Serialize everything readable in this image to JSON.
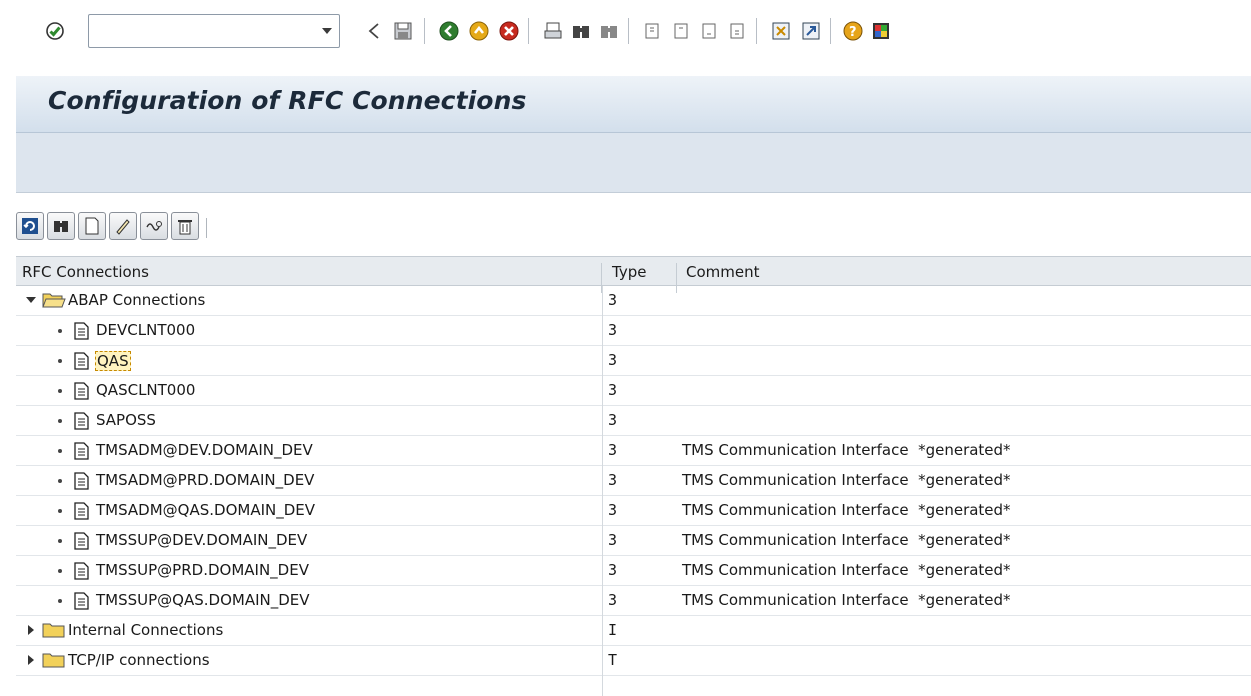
{
  "toolbar": {
    "command_field_value": "",
    "icons": [
      "enter-icon",
      "command-dropdown-icon",
      "back-icon",
      "save-icon",
      "back-green-icon",
      "exit-icon",
      "cancel-icon",
      "print-icon",
      "find-icon",
      "find-next-icon",
      "first-page-icon",
      "previous-page-icon",
      "next-page-icon",
      "last-page-icon",
      "create-session-icon",
      "shortcut-icon",
      "help-icon",
      "customize-layout-icon"
    ]
  },
  "title": "Configuration of RFC Connections",
  "tree_toolbar": {
    "buttons": [
      "refresh-icon",
      "find-icon",
      "create-icon",
      "change-icon",
      "test-connection-icon",
      "delete-icon"
    ]
  },
  "grid": {
    "headers": {
      "name": "RFC Connections",
      "type": "Type",
      "comment": "Comment"
    },
    "nodes": [
      {
        "kind": "folder",
        "expanded": true,
        "label": "ABAP Connections",
        "type": "3",
        "comment": ""
      },
      {
        "kind": "item",
        "label": "DEVCLNT000",
        "type": "3",
        "comment": ""
      },
      {
        "kind": "item",
        "label": "QAS",
        "type": "3",
        "comment": "",
        "selected": true
      },
      {
        "kind": "item",
        "label": "QASCLNT000",
        "type": "3",
        "comment": ""
      },
      {
        "kind": "item",
        "label": "SAPOSS",
        "type": "3",
        "comment": ""
      },
      {
        "kind": "item",
        "label": "TMSADM@DEV.DOMAIN_DEV",
        "type": "3",
        "comment": "TMS Communication Interface  *generated*"
      },
      {
        "kind": "item",
        "label": "TMSADM@PRD.DOMAIN_DEV",
        "type": "3",
        "comment": "TMS Communication Interface  *generated*"
      },
      {
        "kind": "item",
        "label": "TMSADM@QAS.DOMAIN_DEV",
        "type": "3",
        "comment": "TMS Communication Interface  *generated*"
      },
      {
        "kind": "item",
        "label": "TMSSUP@DEV.DOMAIN_DEV",
        "type": "3",
        "comment": "TMS Communication Interface  *generated*"
      },
      {
        "kind": "item",
        "label": "TMSSUP@PRD.DOMAIN_DEV",
        "type": "3",
        "comment": "TMS Communication Interface  *generated*"
      },
      {
        "kind": "item",
        "label": "TMSSUP@QAS.DOMAIN_DEV",
        "type": "3",
        "comment": "TMS Communication Interface  *generated*"
      },
      {
        "kind": "folder",
        "expanded": false,
        "label": "Internal Connections",
        "type": "I",
        "comment": ""
      },
      {
        "kind": "folder",
        "expanded": false,
        "label": "TCP/IP connections",
        "type": "T",
        "comment": ""
      }
    ]
  },
  "colors": {
    "title_bg": "#d3dfec",
    "selected_bg": "#fff3c0",
    "folder_yellow": "#f2d15a"
  }
}
